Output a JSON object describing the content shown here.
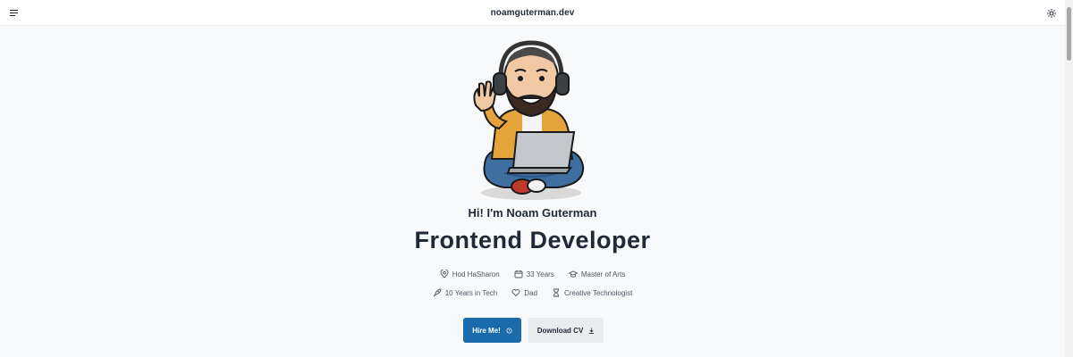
{
  "header": {
    "site_title": "noamguterman.dev",
    "menu_icon": "menu-icon",
    "theme_icon": "sun-icon"
  },
  "hero": {
    "avatar_description": "cartoon-avatar",
    "greeting": "Hi! I'm Noam Guterman",
    "headline": "Frontend Developer",
    "facts_row1": [
      {
        "icon": "location-pin-icon",
        "label": "Hod HaSharon"
      },
      {
        "icon": "calendar-icon",
        "label": "33 Years"
      },
      {
        "icon": "graduation-cap-icon",
        "label": "Master of Arts"
      }
    ],
    "facts_row2": [
      {
        "icon": "rocket-icon",
        "label": "10 Years in Tech"
      },
      {
        "icon": "heart-icon",
        "label": "Dad"
      },
      {
        "icon": "hourglass-icon",
        "label": "Creative Technologist"
      }
    ],
    "hire_label": "Hire Me!",
    "download_label": "Download CV"
  },
  "colors": {
    "primary": "#1a6bab",
    "background": "#f8f9fa",
    "text": "#1f2937"
  }
}
